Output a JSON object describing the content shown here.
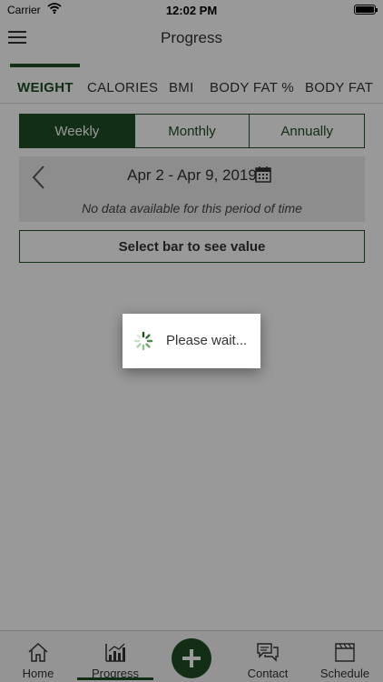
{
  "status_bar": {
    "carrier": "Carrier",
    "time": "12:02 PM"
  },
  "nav": {
    "title": "Progress",
    "menu_icon": "hamburger-menu-icon"
  },
  "metric_tabs": [
    {
      "label": "WEIGHT",
      "active": true
    },
    {
      "label": "CALORIES",
      "active": false
    },
    {
      "label": "BMI",
      "active": false
    },
    {
      "label": "BODY FAT %",
      "active": false
    },
    {
      "label": "BODY FAT",
      "active": false
    }
  ],
  "period_selector": [
    {
      "label": "Weekly",
      "active": true
    },
    {
      "label": "Monthly",
      "active": false
    },
    {
      "label": "Annually",
      "active": false
    }
  ],
  "date_panel": {
    "range": "Apr 2 - Apr 9, 2019",
    "empty_message": "No data available for this period of time",
    "back_icon": "chevron-left-icon",
    "calendar_icon": "calendar-icon"
  },
  "select_bar_label": "Select bar to see value",
  "tab_bar": {
    "items": [
      {
        "label": "Home",
        "icon": "home-icon"
      },
      {
        "label": "Progress",
        "icon": "bar-chart-icon",
        "active": true
      },
      {
        "label": "",
        "icon": "plus-icon"
      },
      {
        "label": "Contact",
        "icon": "chat-bubbles-icon"
      },
      {
        "label": "Schedule",
        "icon": "calendar-schedule-icon"
      }
    ]
  },
  "loading_dialog": {
    "text": "Please wait..."
  },
  "colors": {
    "accent": "#1e4d22",
    "overlay": "rgba(0,0,0,0.40)",
    "panel": "#ececec"
  }
}
